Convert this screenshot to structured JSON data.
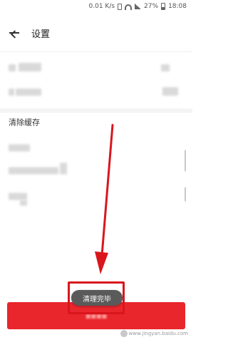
{
  "status_bar": {
    "network_speed": "0.01 K/s",
    "battery": "27%",
    "time": "18:08"
  },
  "header": {
    "title": "设置"
  },
  "sections": {
    "clear_cache_header": "清除缓存"
  },
  "toast": {
    "message": "清理完毕"
  },
  "watermark": {
    "text": "www.jingyan.baidu.com"
  },
  "colors": {
    "accent_red": "#e8262c",
    "arrow_red": "#d9161d",
    "toast_bg": "#5a5a5a"
  },
  "icons": [
    "back-arrow-icon",
    "wifi-icon",
    "signal-icon",
    "battery-icon",
    "vibrate-icon"
  ]
}
